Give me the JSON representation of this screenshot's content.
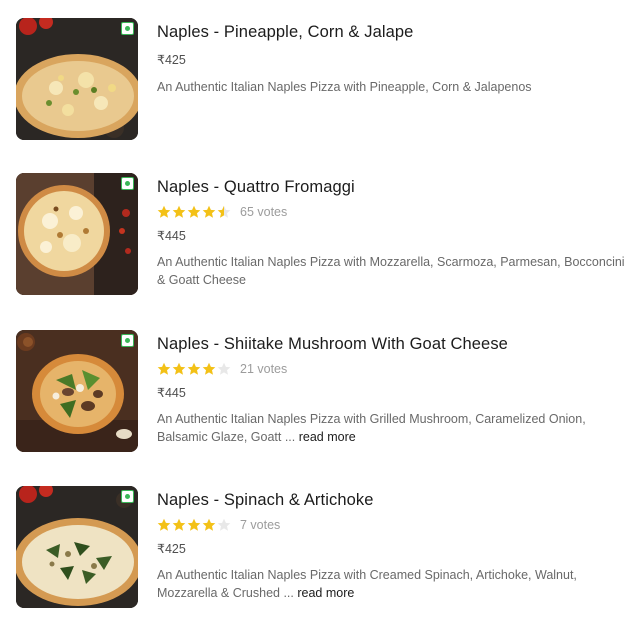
{
  "colors": {
    "star_filled": "#f3c117",
    "star_empty": "#e8e8e8",
    "veg_green": "#3ab757",
    "title": "#1c1c1c",
    "muted": "#9c9c9c",
    "description": "#696969"
  },
  "menu_items": [
    {
      "title": "Naples - Pineapple, Corn & Jalape",
      "price": "₹425",
      "rating": null,
      "votes": "",
      "description": "An Authentic Italian Naples Pizza with Pineapple, Corn & Jalapenos",
      "read_more": "",
      "veg_icon": "veg-indicator-icon"
    },
    {
      "title": "Naples - Quattro Fromaggi",
      "price": "₹445",
      "rating": 4.5,
      "votes": "65 votes",
      "description": "An Authentic Italian Naples Pizza with Mozzarella, Scarmoza, Parmesan, Bocconcini & Goatt Cheese",
      "read_more": "",
      "veg_icon": "veg-indicator-icon"
    },
    {
      "title": "Naples - Shiitake Mushroom With Goat Cheese",
      "price": "₹445",
      "rating": 4,
      "votes": "21 votes",
      "description": "An Authentic Italian Naples Pizza with Grilled Mushroom, Caramelized Onion, Balsamic Glaze, Goatt ...",
      "read_more": "read more",
      "veg_icon": "veg-indicator-icon"
    },
    {
      "title": "Naples - Spinach & Artichoke",
      "price": "₹425",
      "rating": 4,
      "votes": "7 votes",
      "description": "An Authentic Italian Naples Pizza with Creamed Spinach, Artichoke, Walnut, Mozzarella & Crushed ...",
      "read_more": "read more",
      "veg_icon": "veg-indicator-icon"
    }
  ]
}
